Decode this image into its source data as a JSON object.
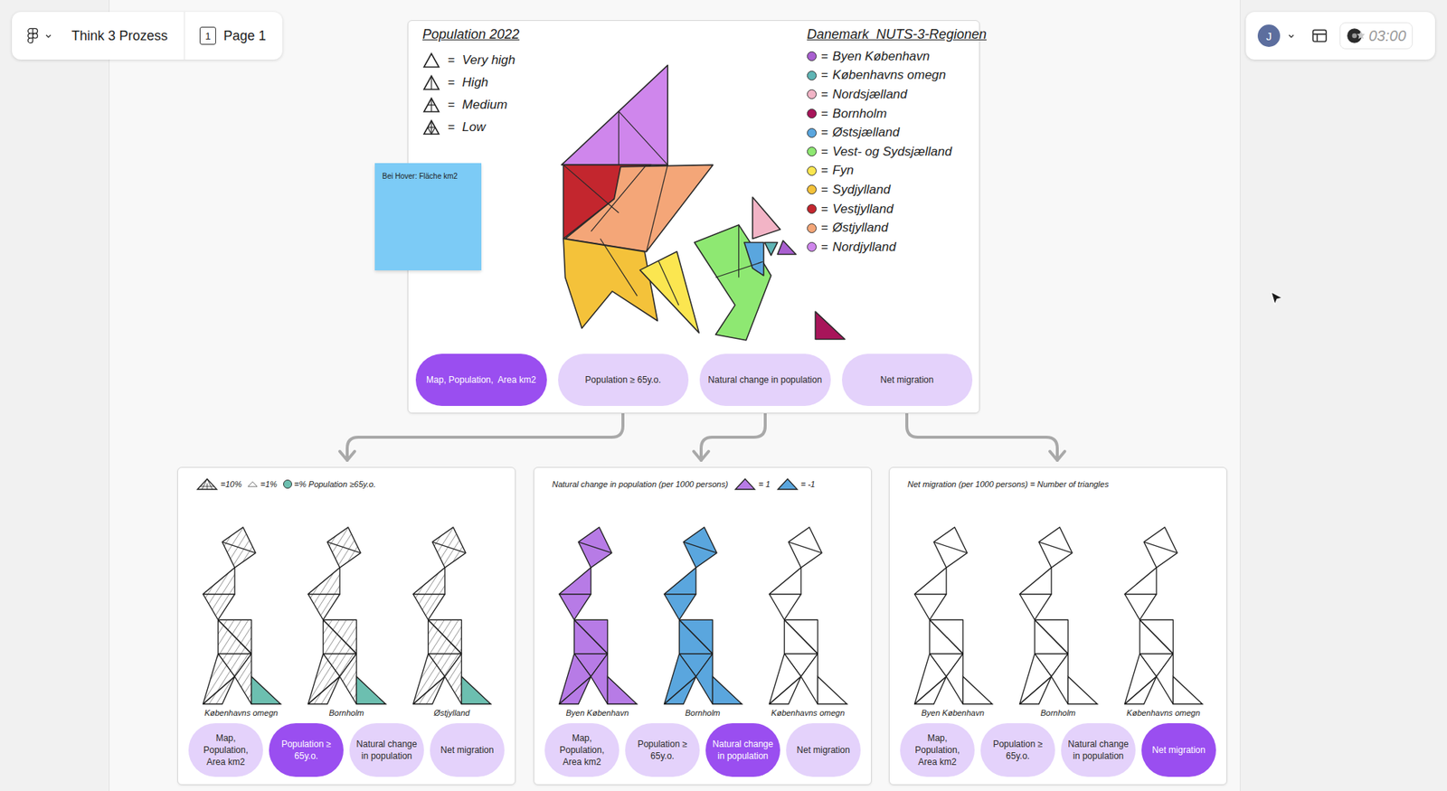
{
  "toolbar": {
    "file": "Think 3 Prozess",
    "page_number": "1",
    "page": "Page 1"
  },
  "user": {
    "avatar": "J",
    "timer": "03:00"
  },
  "overview": {
    "legend_title": "Population 2022",
    "population_levels": [
      {
        "label": "Very high",
        "level": 1
      },
      {
        "label": "High",
        "level": 0.67
      },
      {
        "label": "Medium",
        "level": 0.33
      },
      {
        "label": "Low",
        "level": 0
      }
    ],
    "regions_title": "Danemark  NUTS-3-Regionen",
    "regions": [
      {
        "name": "Byen København",
        "color": "#a95fd0"
      },
      {
        "name": "Københavns omegn",
        "color": "#5fb5b5"
      },
      {
        "name": "Nordsjælland",
        "color": "#f2b4c6"
      },
      {
        "name": "Bornholm",
        "color": "#a8155a"
      },
      {
        "name": "Østsjælland",
        "color": "#5aa6de"
      },
      {
        "name": "Vest- og Sydsjælland",
        "color": "#8ee872"
      },
      {
        "name": "Fyn",
        "color": "#fbe650"
      },
      {
        "name": "Sydjylland",
        "color": "#f4c23a"
      },
      {
        "name": "Vestjylland",
        "color": "#c3262e"
      },
      {
        "name": "Østjylland",
        "color": "#f4a678"
      },
      {
        "name": "Nordjylland",
        "color": "#cf86ec"
      }
    ],
    "sticky": "Bei Hover: Fläche km2",
    "tabs": [
      {
        "label": "Map, Population,  Area km2",
        "selected": true
      },
      {
        "label": "Population ≥ 65y.o.",
        "selected": false
      },
      {
        "label": "Natural change in population",
        "selected": false
      },
      {
        "label": "Net migration",
        "selected": false
      }
    ]
  },
  "details": [
    {
      "title": "",
      "legend": [
        {
          "kind": "hatched",
          "color": "#ffffff",
          "text": "=10%"
        },
        {
          "kind": "small",
          "color": "#ffffff",
          "text": "=1%"
        },
        {
          "kind": "dot",
          "color": "#6cbfb0",
          "text": "=% Population ≥65y.o."
        }
      ],
      "figures": [
        {
          "label": "Københavns omegn",
          "color": "#ffffff",
          "hatched": true,
          "accent": "#6cbfb0"
        },
        {
          "label": "Bornholm",
          "color": "#ffffff",
          "hatched": true,
          "accent": "#6cbfb0"
        },
        {
          "label": "Østjylland",
          "color": "#ffffff",
          "hatched": true,
          "accent": "#6cbfb0"
        }
      ],
      "tabs": [
        {
          "label": "Map, Population, Area km2",
          "selected": false
        },
        {
          "label": "Population ≥ 65y.o.",
          "selected": true
        },
        {
          "label": "Natural change in population",
          "selected": false
        },
        {
          "label": "Net migration",
          "selected": false
        }
      ]
    },
    {
      "title": "Natural change in population (per 1000 persons)",
      "legend": [
        {
          "kind": "triangle",
          "color": "#b77be6",
          "text": "= 1"
        },
        {
          "kind": "triangle",
          "color": "#5aa6de",
          "text": "= -1"
        }
      ],
      "figures": [
        {
          "label": "Byen København",
          "color": "#b77be6",
          "hatched": false,
          "accent": "#b77be6"
        },
        {
          "label": "Bornholm",
          "color": "#5aa6de",
          "hatched": false,
          "accent": "#5aa6de"
        },
        {
          "label": "Københavns omegn",
          "color": "#ffffff",
          "hatched": false,
          "accent": "#ffffff"
        }
      ],
      "tabs": [
        {
          "label": "Map, Population, Area km2",
          "selected": false
        },
        {
          "label": "Population ≥ 65y.o.",
          "selected": false
        },
        {
          "label": "Natural change in population",
          "selected": true
        },
        {
          "label": "Net migration",
          "selected": false
        }
      ]
    },
    {
      "title": "Net migration (per 1000 persons) = Number of triangles",
      "legend": [],
      "figures": [
        {
          "label": "Byen København",
          "color": "#ffffff",
          "hatched": false,
          "accent": "#ffffff"
        },
        {
          "label": "Bornholm",
          "color": "#ffffff",
          "hatched": false,
          "accent": "#ffffff"
        },
        {
          "label": "Københavns omegn",
          "color": "#ffffff",
          "hatched": false,
          "accent": "#ffffff"
        }
      ],
      "tabs": [
        {
          "label": "Map, Population, Area km2",
          "selected": false
        },
        {
          "label": "Population ≥ 65y.o.",
          "selected": false
        },
        {
          "label": "Natural change in population",
          "selected": false
        },
        {
          "label": "Net migration",
          "selected": true
        }
      ]
    }
  ]
}
